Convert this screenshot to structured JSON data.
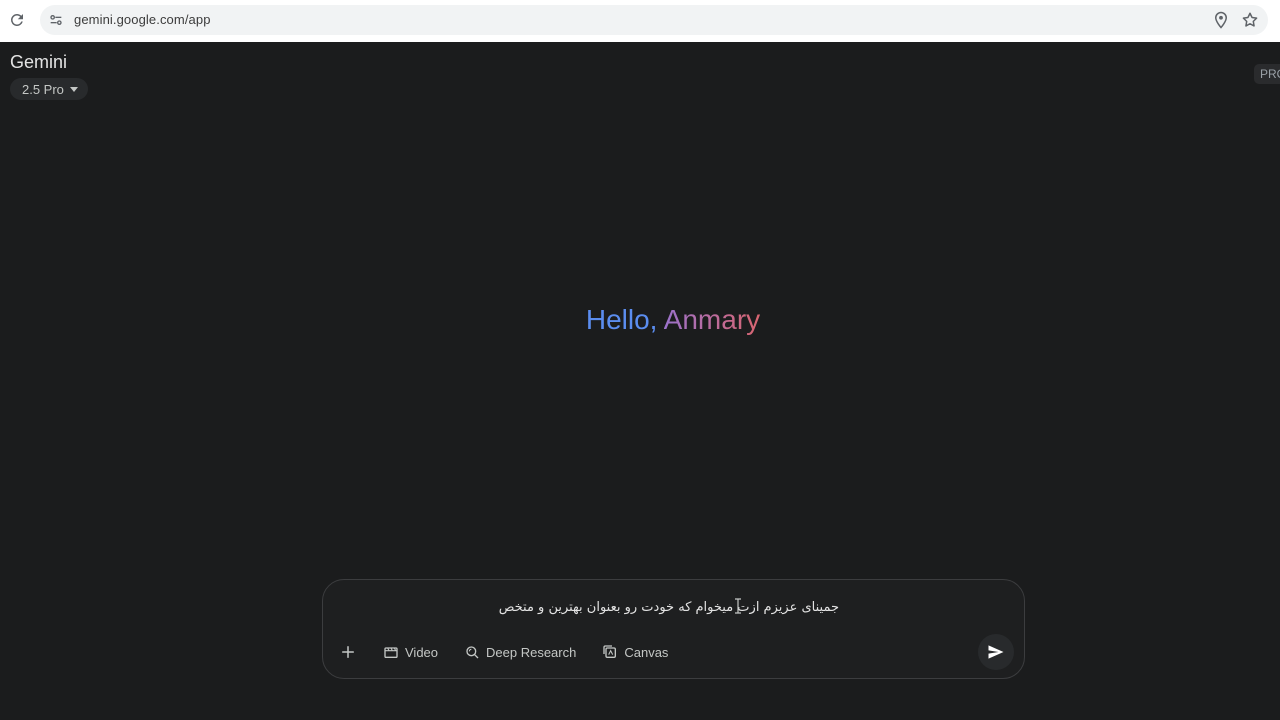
{
  "browser": {
    "url": "gemini.google.com/app"
  },
  "app": {
    "brand": "Gemini",
    "model": "2.5 Pro",
    "badge": "PRO",
    "greeting_hello": "Hello,",
    "greeting_name": "Anmary"
  },
  "prompt": {
    "value": "جمینای عزیزم ازت میخوام که خودت رو بعنوان بهترین و متخص",
    "tools": [
      {
        "label": "Video",
        "icon": "video-icon"
      },
      {
        "label": "Deep Research",
        "icon": "deep-research-icon"
      },
      {
        "label": "Canvas",
        "icon": "canvas-icon"
      }
    ]
  },
  "colors": {
    "background": "#1b1c1d",
    "hello": "#5b8def",
    "name_gradient_start": "#9b72cb",
    "name_gradient_end": "#d96570"
  }
}
